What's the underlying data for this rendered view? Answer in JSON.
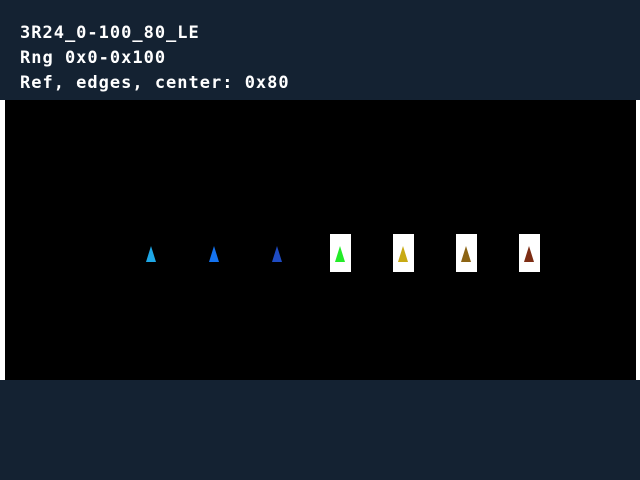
{
  "header": {
    "lines": [
      "3R24_0-100_80_LE",
      "Rng 0x0-0x100",
      "Ref, edges, center: 0x80"
    ]
  },
  "colors": {
    "background": "#142232",
    "stage": "#000000",
    "edge": "#ffffff",
    "marker_box": "#ffffff"
  },
  "markers": [
    {
      "color": "#1ea7e6",
      "boxed": false
    },
    {
      "color": "#1473f0",
      "boxed": false
    },
    {
      "color": "#1e4bc3",
      "boxed": false
    },
    {
      "color": "#23eb28",
      "boxed": true
    },
    {
      "color": "#c8aa14",
      "boxed": true
    },
    {
      "color": "#8c6414",
      "boxed": true
    },
    {
      "color": "#7d2d14",
      "boxed": true
    }
  ]
}
